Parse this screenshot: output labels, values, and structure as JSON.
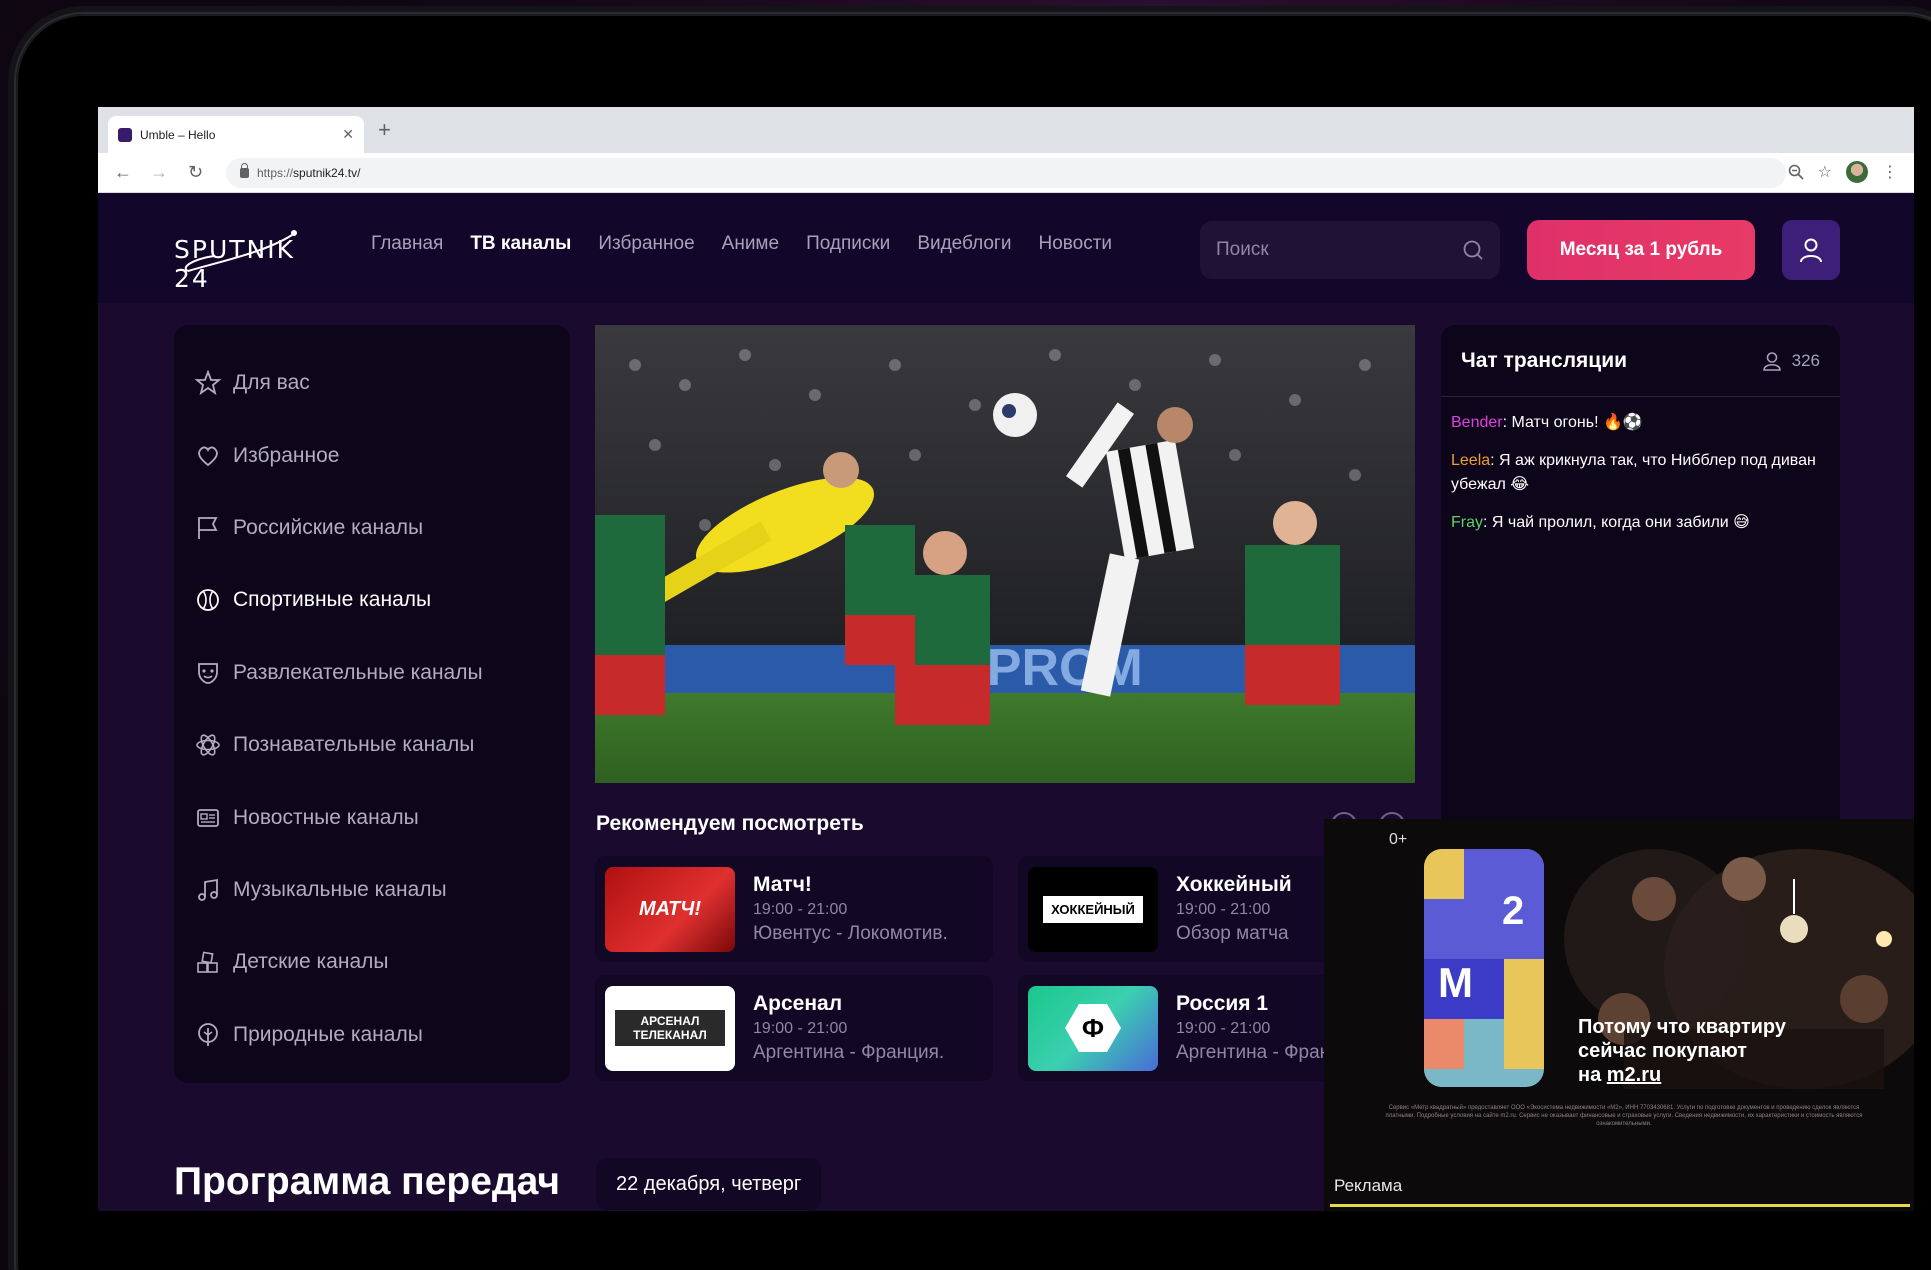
{
  "browser": {
    "tab_title": "Umble – Hello",
    "url_scheme": "https://",
    "url_host": "sputnik24.tv/"
  },
  "header": {
    "logo": "SPUTNIK 24",
    "nav": [
      {
        "label": "Главная",
        "active": false
      },
      {
        "label": "ТВ каналы",
        "active": true
      },
      {
        "label": "Избранное",
        "active": false
      },
      {
        "label": "Аниме",
        "active": false
      },
      {
        "label": "Подписки",
        "active": false
      },
      {
        "label": "Видеблоги",
        "active": false
      },
      {
        "label": "Новости",
        "active": false
      }
    ],
    "search_placeholder": "Поиск",
    "cta_label": "Месяц за 1 рубль"
  },
  "sidebar": {
    "items": [
      {
        "label": "Для вас",
        "icon": "star-icon"
      },
      {
        "label": "Избранное",
        "icon": "heart-icon"
      },
      {
        "label": "Российские каналы",
        "icon": "flag-icon"
      },
      {
        "label": "Спортивные каналы",
        "icon": "ball-icon",
        "active": true
      },
      {
        "label": "Развлекательные каналы",
        "icon": "mask-icon"
      },
      {
        "label": "Познавательные каналы",
        "icon": "atom-icon"
      },
      {
        "label": "Новостные каналы",
        "icon": "newspaper-icon"
      },
      {
        "label": "Музыкальные каналы",
        "icon": "music-note-icon"
      },
      {
        "label": "Детские каналы",
        "icon": "blocks-icon"
      },
      {
        "label": "Природные каналы",
        "icon": "leaf-icon"
      }
    ]
  },
  "recommend": {
    "title": "Рекомендуем посмотреть",
    "cards": [
      {
        "name": "Матч!",
        "time": "19:00 - 21:00",
        "desc": "Ювентус - Локомотив.",
        "logo": "МАТЧ!"
      },
      {
        "name": "Хоккейный",
        "time": "19:00 - 21:00",
        "desc": "Обзор матча",
        "logo": "ХОККЕЙНЫЙ"
      },
      {
        "name": "Арсенал",
        "time": "19:00 - 21:00",
        "desc": "Аргентина - Франция.",
        "logo": "АРСЕНАЛ ТЕЛЕКАНАЛ"
      },
      {
        "name": "Россия 1",
        "time": "19:00 - 21:00",
        "desc": "Аргентина - Франция.",
        "logo": "Ф"
      }
    ]
  },
  "program": {
    "title": "Программа передач",
    "date": "22 декабря, четверг"
  },
  "chat": {
    "title": "Чат трансляции",
    "viewers": "326",
    "messages": [
      {
        "user": "Bender",
        "color": "#e040e0",
        "text": ": Матч огонь! 🔥⚽"
      },
      {
        "user": "Leela",
        "color": "#f0a030",
        "text": ": Я аж крикнула так, что Нибблер под диван убежал 😂"
      },
      {
        "user": "Fray",
        "color": "#60d060",
        "text": ": Я чай пролил, когда они забили 😅"
      }
    ]
  },
  "ad": {
    "age": "0+",
    "brand_letters": [
      "2",
      "М"
    ],
    "tagline_1": "Потому что квартиру",
    "tagline_2": "сейчас покупают",
    "tagline_3_prefix": "на ",
    "tagline_3_link": "m2.ru",
    "fine_print": "Сервис «Метр квадратный» предоставляет ООО «Экосистема недвижимости «М2», ИНН 7703430681. Услуги по подготовке документов и проведению сделок являются платными. Подробные условия на сайте m2.ru. Сервис не оказывает финансовые и страховые услуги. Сведения недвижимости, их характеристики и стоимость являются ознакомительными.",
    "label": "Реклама"
  },
  "colors": {
    "accent": "#e0306a",
    "header_bg": "#12072a",
    "page_bg": "#1a0b2e"
  }
}
